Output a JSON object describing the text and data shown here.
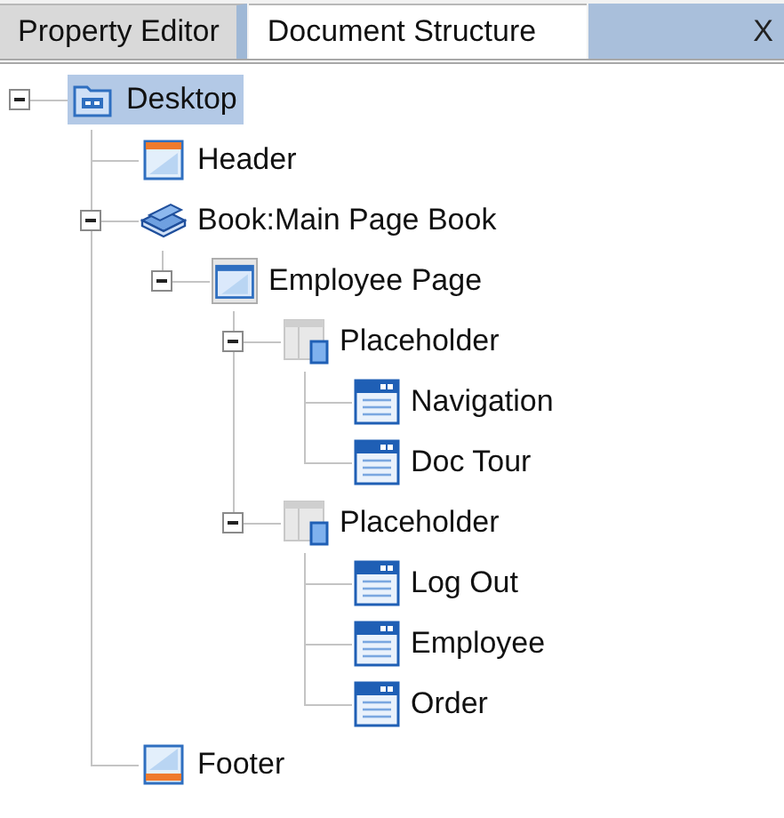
{
  "tabs": [
    {
      "label": "Property Editor",
      "selected": false
    },
    {
      "label": "Document Structure",
      "selected": true
    }
  ],
  "close": "X",
  "tree": [
    {
      "label": "Desktop",
      "kind": "desktop",
      "selected": true,
      "expanded": true,
      "children": [
        {
          "label": "Header",
          "kind": "header",
          "selected": false
        },
        {
          "label": "Book:Main Page Book",
          "kind": "book",
          "selected": false,
          "expanded": true,
          "children": [
            {
              "label": "Employee Page",
              "kind": "page",
              "selected": false,
              "expanded": true,
              "children": [
                {
                  "label": "Placeholder",
                  "kind": "placeholder",
                  "selected": false,
                  "expanded": true,
                  "children": [
                    {
                      "label": "Navigation",
                      "kind": "panel",
                      "selected": false
                    },
                    {
                      "label": "Doc Tour",
                      "kind": "panel",
                      "selected": false
                    }
                  ]
                },
                {
                  "label": "Placeholder",
                  "kind": "placeholder",
                  "selected": false,
                  "expanded": true,
                  "children": [
                    {
                      "label": "Log Out",
                      "kind": "panel",
                      "selected": false
                    },
                    {
                      "label": "Employee",
                      "kind": "panel",
                      "selected": false
                    },
                    {
                      "label": "Order",
                      "kind": "panel",
                      "selected": false
                    }
                  ]
                }
              ]
            }
          ]
        },
        {
          "label": "Footer",
          "kind": "footer",
          "selected": false
        }
      ]
    }
  ]
}
